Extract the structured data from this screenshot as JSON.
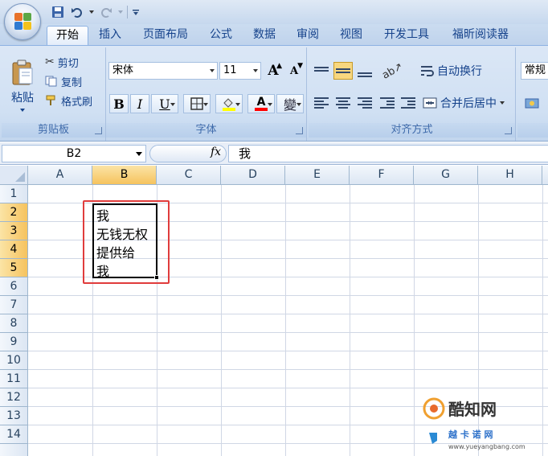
{
  "qat": {
    "icons": [
      "save-icon",
      "undo-icon",
      "redo-icon",
      "customize-icon"
    ]
  },
  "tabs": [
    {
      "label": "开始",
      "active": true
    },
    {
      "label": "插入"
    },
    {
      "label": "页面布局"
    },
    {
      "label": "公式"
    },
    {
      "label": "数据"
    },
    {
      "label": "审阅"
    },
    {
      "label": "视图"
    },
    {
      "label": "开发工具"
    },
    {
      "label": "福昕阅读器"
    }
  ],
  "clipboard": {
    "paste": "粘贴",
    "cut": "剪切",
    "copy": "复制",
    "format_painter": "格式刷",
    "group_label": "剪贴板"
  },
  "font": {
    "name": "宋体",
    "size": "11",
    "grow": "A",
    "shrink": "A",
    "bold": "B",
    "italic": "I",
    "underline": "U",
    "font_color_letter": "A",
    "phonetic": "變",
    "group_label": "字体",
    "highlight_color": "#ffff00",
    "font_color": "#ff0000"
  },
  "alignment": {
    "wrap_text": "自动换行",
    "merge_center": "合并后居中",
    "group_label": "对齐方式"
  },
  "number": {
    "format": "常规"
  },
  "formula_bar": {
    "name_box": "B2",
    "fx": "fx",
    "content": "我"
  },
  "sheet": {
    "columns": [
      "A",
      "B",
      "C",
      "D",
      "E",
      "F",
      "G",
      "H"
    ],
    "rows": [
      "1",
      "2",
      "3",
      "4",
      "5",
      "6",
      "7",
      "8",
      "9",
      "10",
      "11",
      "12",
      "13",
      "14"
    ],
    "selected_column": "B",
    "selected_rows": [
      "2",
      "3",
      "4",
      "5"
    ],
    "cells": {
      "B2": "我",
      "B3": "无钱无权",
      "B4": "提供给",
      "B5": "我"
    }
  },
  "watermark": {
    "brand": "酷知网",
    "sub": "越  卡  诺  网",
    "url": "www.yueyangbang.com"
  },
  "colors": {
    "highlight_box": "#e03c3c",
    "header_selected": "#f6c35e"
  }
}
